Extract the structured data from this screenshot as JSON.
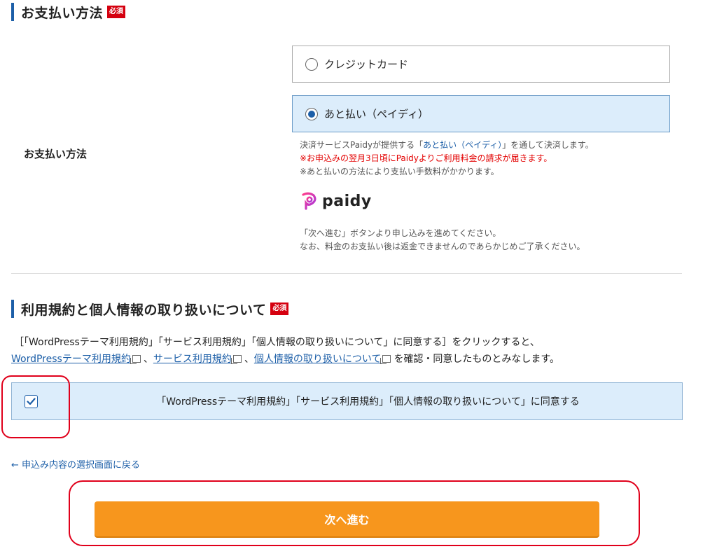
{
  "payment": {
    "heading": "お支払い方法",
    "required": "必須",
    "row_label": "お支払い方法",
    "options": [
      {
        "label": "クレジットカード",
        "selected": false
      },
      {
        "label": "あと払い（ペイディ）",
        "selected": true
      }
    ],
    "notes": {
      "line1_pre": "決済サービスPaidyが提供する「",
      "line1_link": "あと払い（ペイディ）",
      "line1_post": "」を通して決済します。",
      "line2": "※お申込みの翌月3日頃にPaidyよりご利用料金の請求が届きます。",
      "line3": "※あと払いの方法により支払い手数料がかかります。",
      "line4": "「次へ進む」ボタンより申し込みを進めてください。",
      "line5": "なお、料金のお支払い後は返金できませんのであらかじめご了承ください。"
    },
    "logo_text": "paidy"
  },
  "terms": {
    "heading": "利用規約と個人情報の取り扱いについて",
    "required": "必須",
    "line1": "［「WordPressテーマ利用規約」「サービス利用規約」「個人情報の取り扱いについて」に同意する］をクリックすると、",
    "link1": "WordPressテーマ利用規約",
    "link2": "サービス利用規約",
    "link3": "個人情報の取り扱いについて",
    "sep": "、",
    "line2_post": "を確認・同意したものとみなします。",
    "agree_label": "「WordPressテーマ利用規約」「サービス利用規約」「個人情報の取り扱いについて」に同意する",
    "agree_checked": true
  },
  "nav": {
    "back_label": "← 申込み内容の選択画面に戻る",
    "next_label": "次へ進む"
  },
  "colors": {
    "accent": "#1d5fa8",
    "required_badge": "#d5000f",
    "next_button": "#f7961d",
    "annotation": "#e0001b"
  }
}
